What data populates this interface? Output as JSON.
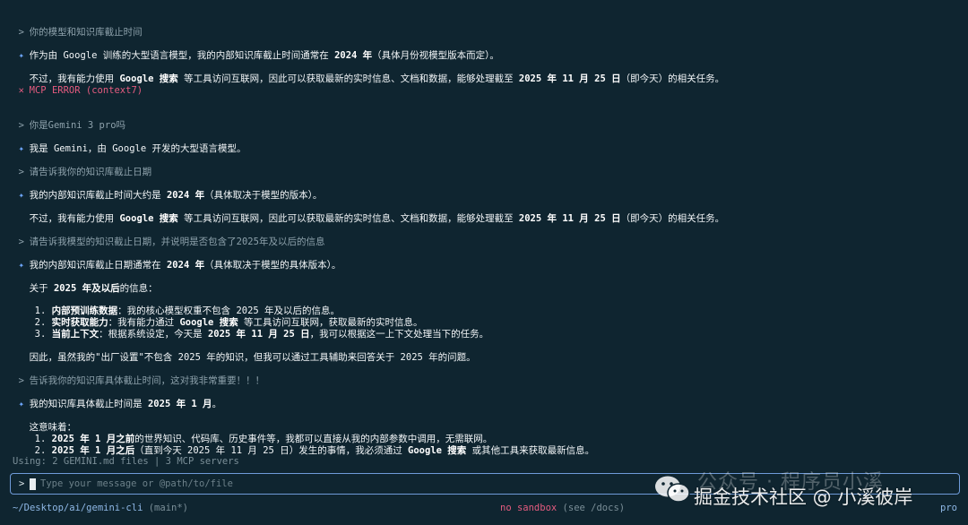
{
  "conversation": {
    "q1": "你的模型和知识库截止时间",
    "a1_line1": [
      "作为由 Google 训练的大型语言模型，我的内部知识库截止时间通常在 ",
      "2024 年",
      "（具体月份视模型版本而定）。"
    ],
    "a1_line2": [
      "不过，我有能力使用 ",
      "Google 搜索",
      " 等工具访问互联网，因此可以获取最新的实时信息、文档和数据，能够处理截至 ",
      "2025 年 11 月 25 日",
      "（即今天）的相关任务。"
    ],
    "error": "MCP ERROR (context7)",
    "q2": "你是Gemini 3 pro吗",
    "a2": "我是 Gemini，由 Google 开发的大型语言模型。",
    "q3": "请告诉我你的知识库截止日期",
    "a3_line1": [
      "我的内部知识库截止时间大约是 ",
      "2024 年",
      "（具体取决于模型的版本）。"
    ],
    "a3_line2": [
      "不过，我有能力使用 ",
      "Google 搜索",
      " 等工具访问互联网，因此可以获取最新的实时信息、文档和数据，能够处理截至 ",
      "2025 年 11 月 25 日",
      "（即今天）的相关任务。"
    ],
    "q4": "请告诉我模型的知识截止日期，并说明是否包含了2025年及以后的信息",
    "a4_line1": [
      "我的内部知识库截止日期通常在 ",
      "2024 年",
      "（具体取决于模型的具体版本）。"
    ],
    "a4_line2": [
      "关于 ",
      "2025 年及以后",
      "的信息："
    ],
    "a4_item1": [
      "1. ",
      "内部预训练数据",
      "：我的核心模型权重不包含 2025 年及以后的信息。"
    ],
    "a4_item2": [
      "2. ",
      "实时获取能力",
      "：我有能力通过 ",
      "Google 搜索",
      " 等工具访问互联网，获取最新的实时信息。"
    ],
    "a4_item3": [
      "3. ",
      "当前上下文",
      "：根据系统设定，今天是 ",
      "2025 年 11 月 25 日",
      "，我可以根据这一上下文处理当下的任务。"
    ],
    "a4_line3": "因此，虽然我的\"出厂设置\"不包含 2025 年的知识，但我可以通过工具辅助来回答关于 2025 年的问题。",
    "q5": "告诉我你的知识库具体截止时间，这对我非常重要！！！",
    "a5_line1": [
      "我的知识库具体截止时间是 ",
      "2025 年 1 月",
      "。"
    ],
    "a5_line2": "这意味着：",
    "a5_item1": [
      "1. ",
      "2025 年 1 月之前",
      "的世界知识、代码库、历史事件等，我都可以直接从我的内部参数中调用，无需联网。"
    ],
    "a5_item2": [
      "2. ",
      "2025 年 1 月之后",
      "（直到今天 2025 年 11 月 25 日）发生的事情，我必须通过 ",
      "Google 搜索",
      " 或其他工具来获取最新信息。"
    ]
  },
  "prefixes": {
    "user": ">",
    "assistant": "✦",
    "error": "✕"
  },
  "status": {
    "context": "Using: 2 GEMINI.md files | 3 MCP servers"
  },
  "input": {
    "prompt": ">",
    "placeholder": "Type your message or @path/to/file"
  },
  "footer": {
    "path": "~/Desktop/ai/gemini-cli",
    "branch": "(main*)",
    "sandbox": "no sandbox",
    "sandbox_hint": "(see /docs)",
    "model": "pro"
  },
  "watermark": {
    "top": "公众号 · 程序员小溪",
    "bottom": "掘金技术社区 @ 小溪彼岸"
  },
  "colors": {
    "background": "#0f2530",
    "accent": "#6fa8ff",
    "error": "#e45b7f",
    "input_border": "#6f9bd9"
  }
}
